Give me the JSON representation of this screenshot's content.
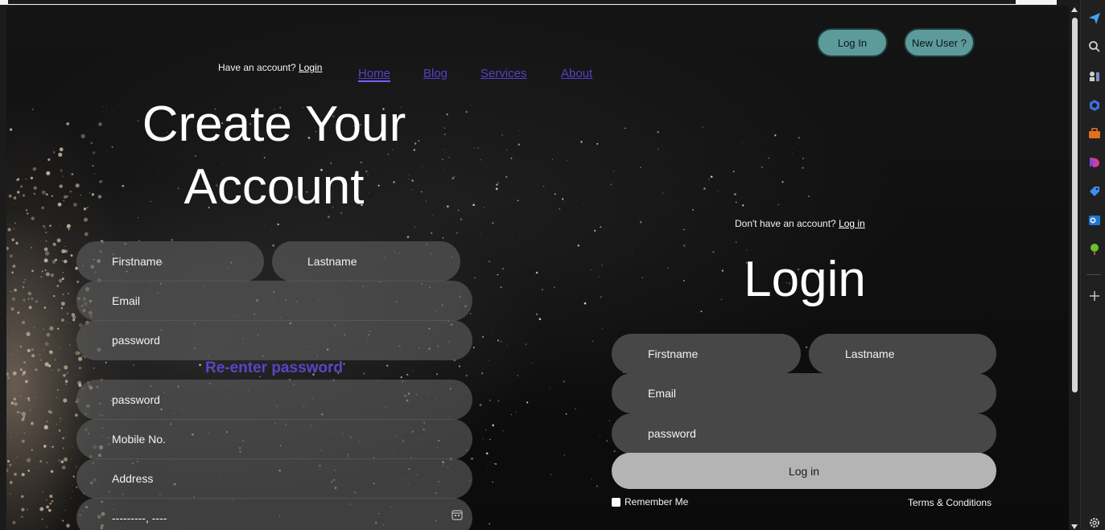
{
  "header": {
    "login_button": "Log In",
    "new_user_button": "New User ?",
    "have_account_text": "Have an account?",
    "have_account_link": "Login"
  },
  "nav": {
    "items": [
      "Home",
      "Blog",
      "Services",
      "About"
    ]
  },
  "signup": {
    "title_line1": "Create Your",
    "title_line2": "Account",
    "firstname": "Firstname",
    "lastname": "Lastname",
    "email": "Email",
    "password": "password",
    "reenter_label": "Re-enter password",
    "reenter_password": "password",
    "mobile": "Mobile No.",
    "address": "Address",
    "date_placeholder": "---------, ----"
  },
  "login": {
    "dont_have_text": "Don't have an account?",
    "dont_have_link": "Log in",
    "title": "Login",
    "firstname": "Firstname",
    "lastname": "Lastname",
    "email": "Email",
    "password": "password",
    "submit": "Log in",
    "remember_me": "Remember Me",
    "terms": "Terms & Conditions"
  },
  "colors": {
    "accent_button": "#5d9b9b",
    "nav_link": "#5b3ec8",
    "reenter_label": "#5a45c4"
  }
}
